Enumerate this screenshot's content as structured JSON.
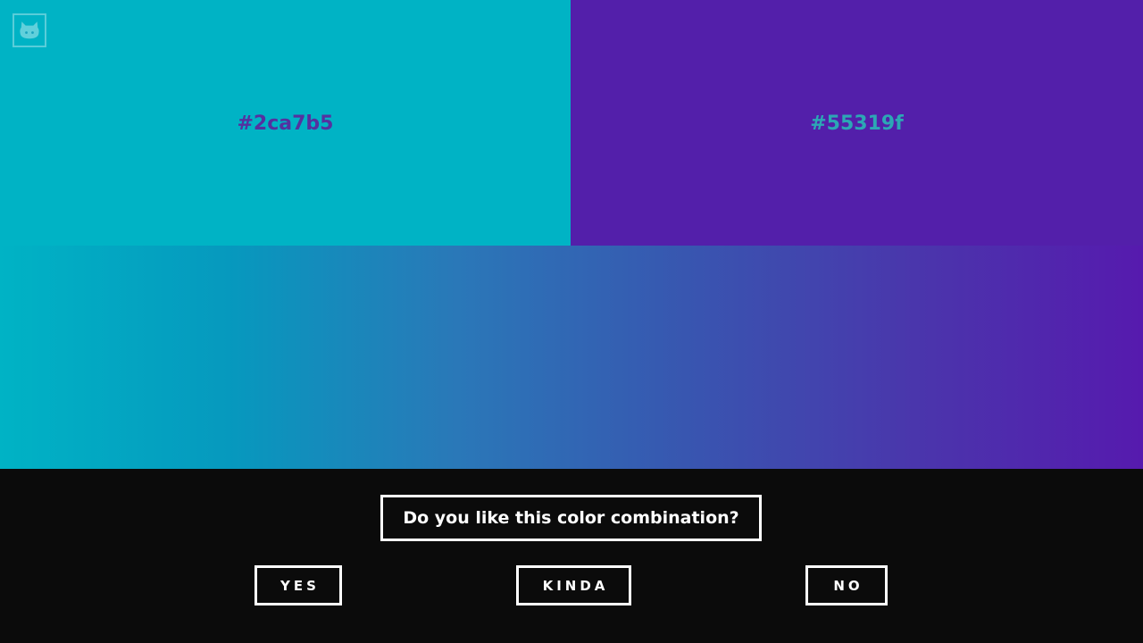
{
  "colors": {
    "left": "#00b3c5",
    "right": "#531faa",
    "left_label_color": "#55319f",
    "right_label_color": "#2ca7b5",
    "gradient_stops": [
      "#00b3c5",
      "#0699be",
      "#2a78b8",
      "#3856b0",
      "#4a36ac",
      "#561aae"
    ]
  },
  "swatches": {
    "left_label": "#2ca7b5",
    "right_label": "#55319f"
  },
  "github": {
    "icon": "github-octocat-icon"
  },
  "prompt": {
    "question": "Do you like this color combination?"
  },
  "buttons": {
    "yes": "YES",
    "kinda": "KINDA",
    "no": "NO"
  }
}
